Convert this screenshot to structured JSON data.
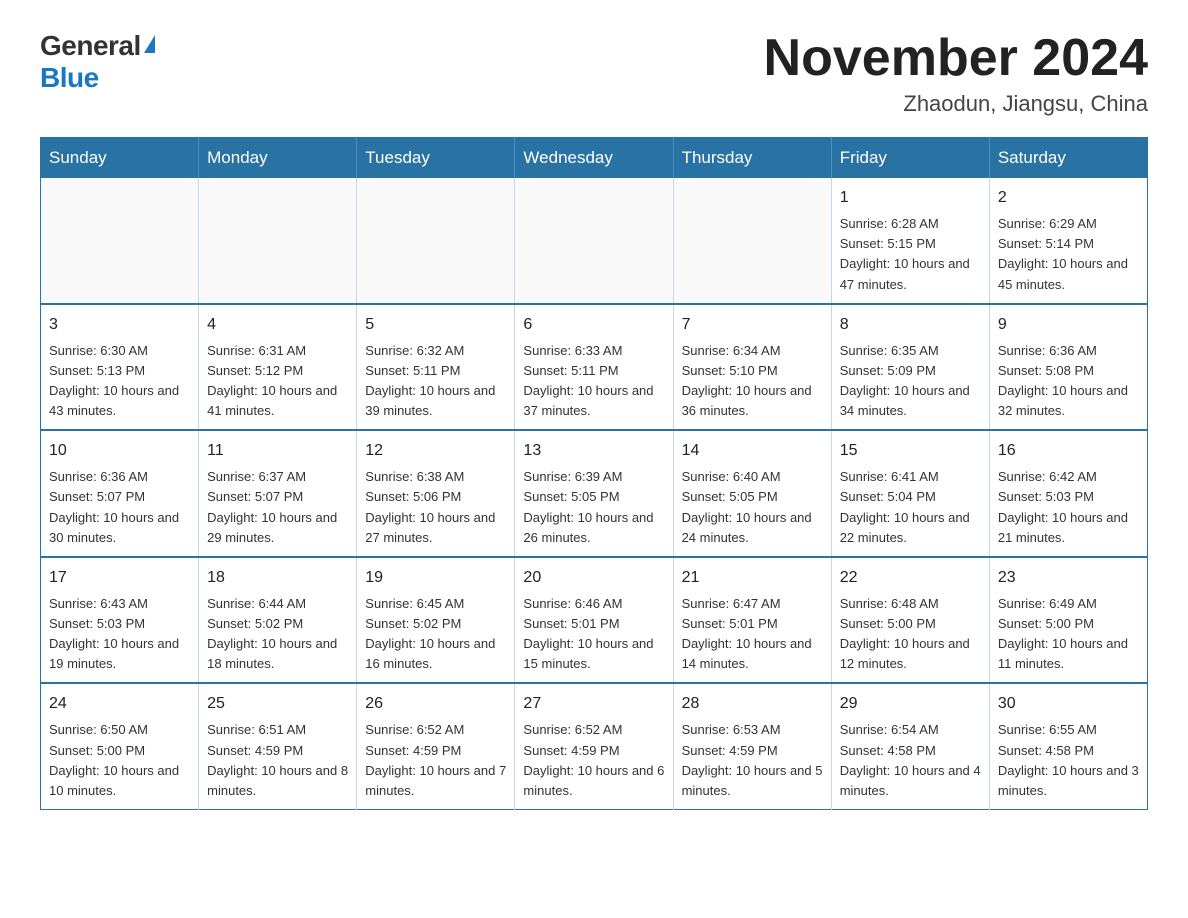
{
  "header": {
    "logo_general": "General",
    "logo_blue": "Blue",
    "month_title": "November 2024",
    "location": "Zhaodun, Jiangsu, China"
  },
  "days_of_week": [
    "Sunday",
    "Monday",
    "Tuesday",
    "Wednesday",
    "Thursday",
    "Friday",
    "Saturday"
  ],
  "weeks": [
    [
      {
        "day": "",
        "info": ""
      },
      {
        "day": "",
        "info": ""
      },
      {
        "day": "",
        "info": ""
      },
      {
        "day": "",
        "info": ""
      },
      {
        "day": "",
        "info": ""
      },
      {
        "day": "1",
        "info": "Sunrise: 6:28 AM\nSunset: 5:15 PM\nDaylight: 10 hours and 47 minutes."
      },
      {
        "day": "2",
        "info": "Sunrise: 6:29 AM\nSunset: 5:14 PM\nDaylight: 10 hours and 45 minutes."
      }
    ],
    [
      {
        "day": "3",
        "info": "Sunrise: 6:30 AM\nSunset: 5:13 PM\nDaylight: 10 hours and 43 minutes."
      },
      {
        "day": "4",
        "info": "Sunrise: 6:31 AM\nSunset: 5:12 PM\nDaylight: 10 hours and 41 minutes."
      },
      {
        "day": "5",
        "info": "Sunrise: 6:32 AM\nSunset: 5:11 PM\nDaylight: 10 hours and 39 minutes."
      },
      {
        "day": "6",
        "info": "Sunrise: 6:33 AM\nSunset: 5:11 PM\nDaylight: 10 hours and 37 minutes."
      },
      {
        "day": "7",
        "info": "Sunrise: 6:34 AM\nSunset: 5:10 PM\nDaylight: 10 hours and 36 minutes."
      },
      {
        "day": "8",
        "info": "Sunrise: 6:35 AM\nSunset: 5:09 PM\nDaylight: 10 hours and 34 minutes."
      },
      {
        "day": "9",
        "info": "Sunrise: 6:36 AM\nSunset: 5:08 PM\nDaylight: 10 hours and 32 minutes."
      }
    ],
    [
      {
        "day": "10",
        "info": "Sunrise: 6:36 AM\nSunset: 5:07 PM\nDaylight: 10 hours and 30 minutes."
      },
      {
        "day": "11",
        "info": "Sunrise: 6:37 AM\nSunset: 5:07 PM\nDaylight: 10 hours and 29 minutes."
      },
      {
        "day": "12",
        "info": "Sunrise: 6:38 AM\nSunset: 5:06 PM\nDaylight: 10 hours and 27 minutes."
      },
      {
        "day": "13",
        "info": "Sunrise: 6:39 AM\nSunset: 5:05 PM\nDaylight: 10 hours and 26 minutes."
      },
      {
        "day": "14",
        "info": "Sunrise: 6:40 AM\nSunset: 5:05 PM\nDaylight: 10 hours and 24 minutes."
      },
      {
        "day": "15",
        "info": "Sunrise: 6:41 AM\nSunset: 5:04 PM\nDaylight: 10 hours and 22 minutes."
      },
      {
        "day": "16",
        "info": "Sunrise: 6:42 AM\nSunset: 5:03 PM\nDaylight: 10 hours and 21 minutes."
      }
    ],
    [
      {
        "day": "17",
        "info": "Sunrise: 6:43 AM\nSunset: 5:03 PM\nDaylight: 10 hours and 19 minutes."
      },
      {
        "day": "18",
        "info": "Sunrise: 6:44 AM\nSunset: 5:02 PM\nDaylight: 10 hours and 18 minutes."
      },
      {
        "day": "19",
        "info": "Sunrise: 6:45 AM\nSunset: 5:02 PM\nDaylight: 10 hours and 16 minutes."
      },
      {
        "day": "20",
        "info": "Sunrise: 6:46 AM\nSunset: 5:01 PM\nDaylight: 10 hours and 15 minutes."
      },
      {
        "day": "21",
        "info": "Sunrise: 6:47 AM\nSunset: 5:01 PM\nDaylight: 10 hours and 14 minutes."
      },
      {
        "day": "22",
        "info": "Sunrise: 6:48 AM\nSunset: 5:00 PM\nDaylight: 10 hours and 12 minutes."
      },
      {
        "day": "23",
        "info": "Sunrise: 6:49 AM\nSunset: 5:00 PM\nDaylight: 10 hours and 11 minutes."
      }
    ],
    [
      {
        "day": "24",
        "info": "Sunrise: 6:50 AM\nSunset: 5:00 PM\nDaylight: 10 hours and 10 minutes."
      },
      {
        "day": "25",
        "info": "Sunrise: 6:51 AM\nSunset: 4:59 PM\nDaylight: 10 hours and 8 minutes."
      },
      {
        "day": "26",
        "info": "Sunrise: 6:52 AM\nSunset: 4:59 PM\nDaylight: 10 hours and 7 minutes."
      },
      {
        "day": "27",
        "info": "Sunrise: 6:52 AM\nSunset: 4:59 PM\nDaylight: 10 hours and 6 minutes."
      },
      {
        "day": "28",
        "info": "Sunrise: 6:53 AM\nSunset: 4:59 PM\nDaylight: 10 hours and 5 minutes."
      },
      {
        "day": "29",
        "info": "Sunrise: 6:54 AM\nSunset: 4:58 PM\nDaylight: 10 hours and 4 minutes."
      },
      {
        "day": "30",
        "info": "Sunrise: 6:55 AM\nSunset: 4:58 PM\nDaylight: 10 hours and 3 minutes."
      }
    ]
  ]
}
